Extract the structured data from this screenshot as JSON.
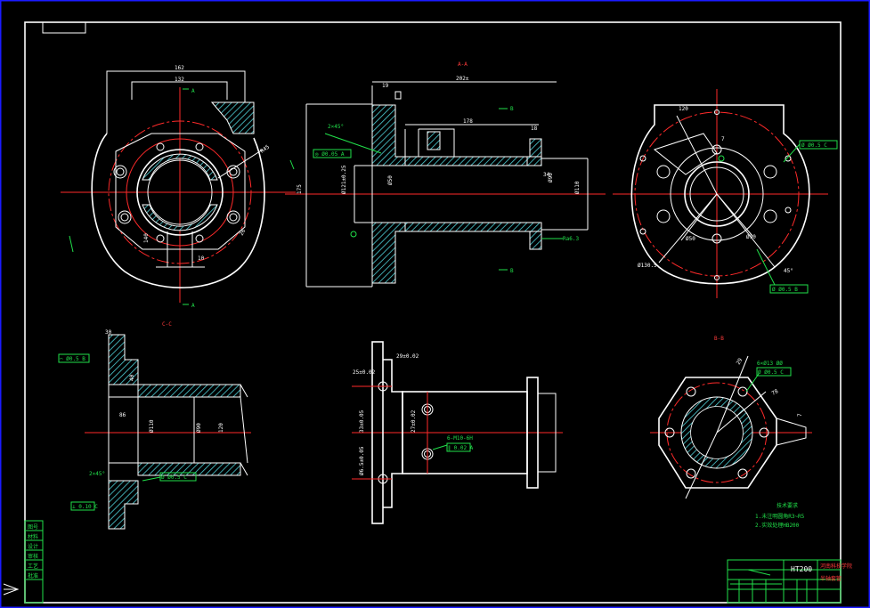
{
  "title_block": {
    "material": "HT200",
    "school": "河南科技学院",
    "part_name": "半轴套管"
  },
  "section_labels": {
    "section_aa": "A-A",
    "section_bb": "B-B",
    "section_cc": "C-C",
    "arrow_a": "A",
    "arrow_b": "B"
  },
  "dimensions": {
    "top_width_162": "162",
    "top_width_132": "132",
    "length_202": "202±",
    "length_178": "178",
    "radius_45": "R45",
    "dia_121": "Ø121±0.25",
    "dia_110": "Ø110",
    "dia_90": "Ø90",
    "dia_50_a": "Ø50",
    "bolt_circle": "Ø130.5",
    "angle_45": "45°",
    "length_30": "30",
    "length_40": "40",
    "dims_18": "18",
    "dims_29": "29",
    "dims_86": "86",
    "dims_19": "19",
    "dims_34": "34",
    "dims_10": "10",
    "dims_26": "26",
    "dims_140": "140",
    "dims_175": "175",
    "dims_120": "120",
    "dims_7": "7",
    "dims_78": "78",
    "tol_1": "29±0.02",
    "tol_2": "25±0.02",
    "tol_3": "33±0.05",
    "tol_4": "Ø6.5±0.05",
    "tol_5": "27±0.02",
    "chamfer": "2×45°",
    "thread": "6-M10-6H",
    "hole_spec": "6×Ø13 ØØ",
    "ra_1": "Ra6.3",
    "ra_2": "Ra3.2",
    "gtol_1": "◎ Ø0.05 A",
    "gtol_2": "∥ 0.02 A",
    "gtol_3": "Ø Ø0.5 C",
    "gtol_4": "Ø Ø0.5 B",
    "gtol_5": "⌒ Ø0.5 B",
    "gtol_6": "⟂ 0.10 C",
    "gtol_7": "Ø Ø0.5 C"
  },
  "notes": {
    "heading": "技术要求",
    "line1": "1.未注明圆角R3~R5",
    "line2": "2.实效处理HB200"
  },
  "side_table": [
    "图号",
    "材料",
    "设计",
    "审核",
    "工艺",
    "批准"
  ]
}
